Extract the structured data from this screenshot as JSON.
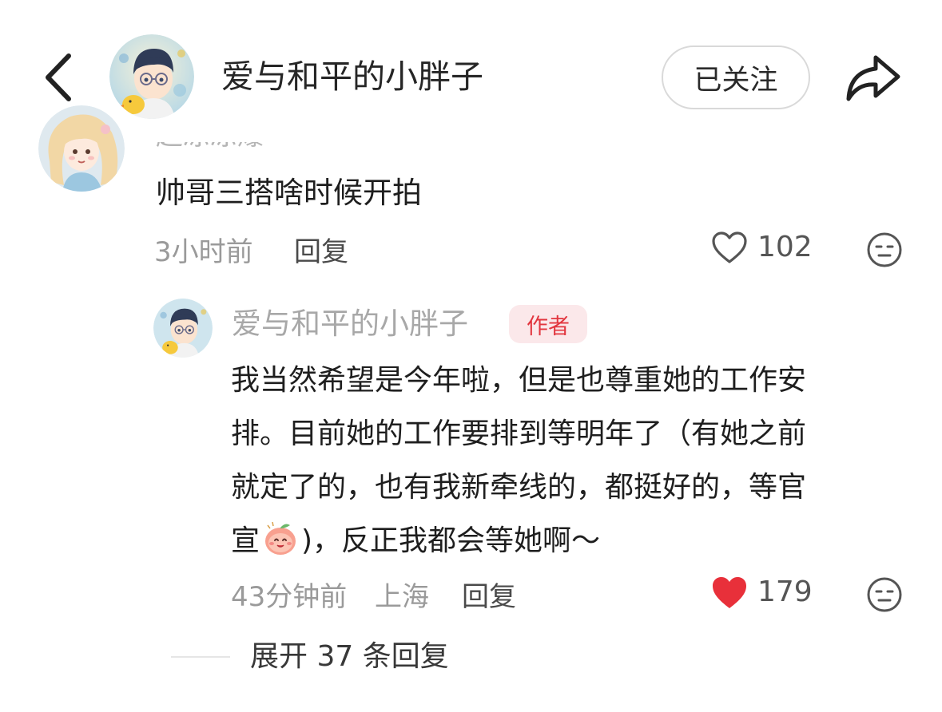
{
  "header": {
    "back_icon": "chevron-left-icon",
    "author_name": "爱与和平的小胖子",
    "follow_label": "已关注",
    "share_icon": "share-arrow-icon"
  },
  "comment": {
    "username_clipped": "超凉凉爆",
    "text": "帅哥三搭啥时候开拍",
    "time": "3小时前",
    "reply_label": "回复",
    "like_icon": "heart-outline-icon",
    "likes": "102",
    "dislike_icon": "neutral-face-icon"
  },
  "reply": {
    "username": "爱与和平的小胖子",
    "badge": "作者",
    "lines": [
      "我当然希望是今年啦，但是也尊重她的工作安",
      "排。目前她的工作要排到等明年了（有她之前",
      "就定了的，也有我新牵线的，都挺好的，等官"
    ],
    "last_line_prefix": "宣",
    "last_line_emoji": "peach-face-emoji",
    "last_line_suffix": ")，反正我都会等她啊～",
    "time": "43分钟前",
    "location": "上海",
    "reply_label": "回复",
    "like_icon": "heart-filled-icon",
    "likes": "179",
    "dislike_icon": "neutral-face-icon"
  },
  "expand": {
    "label": "展开 37 条回复"
  },
  "colors": {
    "liked_red": "#e8303a",
    "author_badge_text": "#e2363f",
    "author_badge_bg": "#fbe8ea"
  }
}
